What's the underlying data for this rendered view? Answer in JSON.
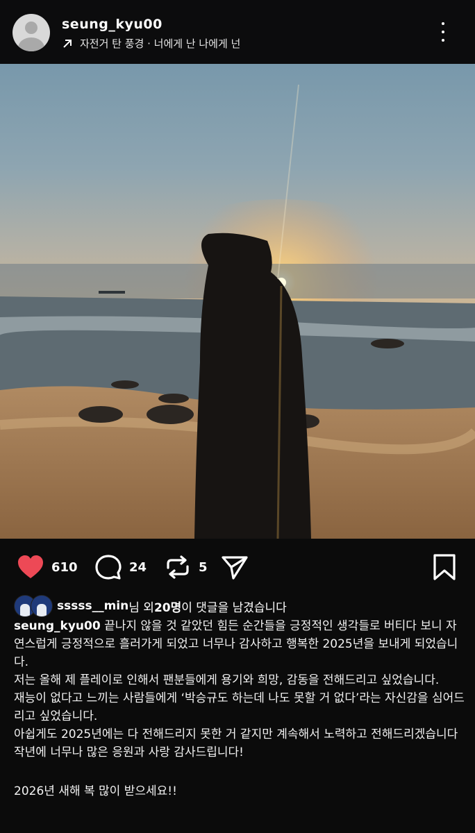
{
  "header": {
    "username": "seung_kyu00",
    "audio_track": "자전거 탄 풍경 · 너에게 난 나에게 넌",
    "audio_icon": "arrow-up-right-icon",
    "more_icon": "more-vertical-icon"
  },
  "photo": {
    "description_icon": "mute-speaker-icon"
  },
  "actions": {
    "likes": "610",
    "comments": "24",
    "reposts": "5",
    "like_color": "#ed4956"
  },
  "commenters": {
    "name": "sssss__min",
    "text_mid": "님 외 ",
    "count": "20명",
    "text_end": "이 댓글을 남겼습니다"
  },
  "caption": {
    "username": "seung_kyu00",
    "line1": " 끝나지 않을 것 같았던 힘든 순간들을 긍정적인 생각들로 버티다 보니 자연스럽게 긍정적으로 흘러가게 되었고 너무나 감사하고 행복한 2025년을 보내게 되었습니다.",
    "line2": "저는 올해 제 플레이로 인해서 팬분들에게 용기와 희망, 감동을 전해드리고 싶었습니다.",
    "line3": "재능이 없다고 느끼는 사람들에게 ‘박승규도 하는데 나도 못할 거 없다’라는 자신감을 심어드리고 싶었습니다.",
    "line4": "아쉽게도 2025년에는 다 전해드리지 못한 거 같지만 계속해서 노력하고 전해드리겠습니다",
    "line5": "작년에 너무나 많은 응원과 사랑 감사드립니다!",
    "line6": " 2026년 새해 복 많이 받으세요!!"
  }
}
